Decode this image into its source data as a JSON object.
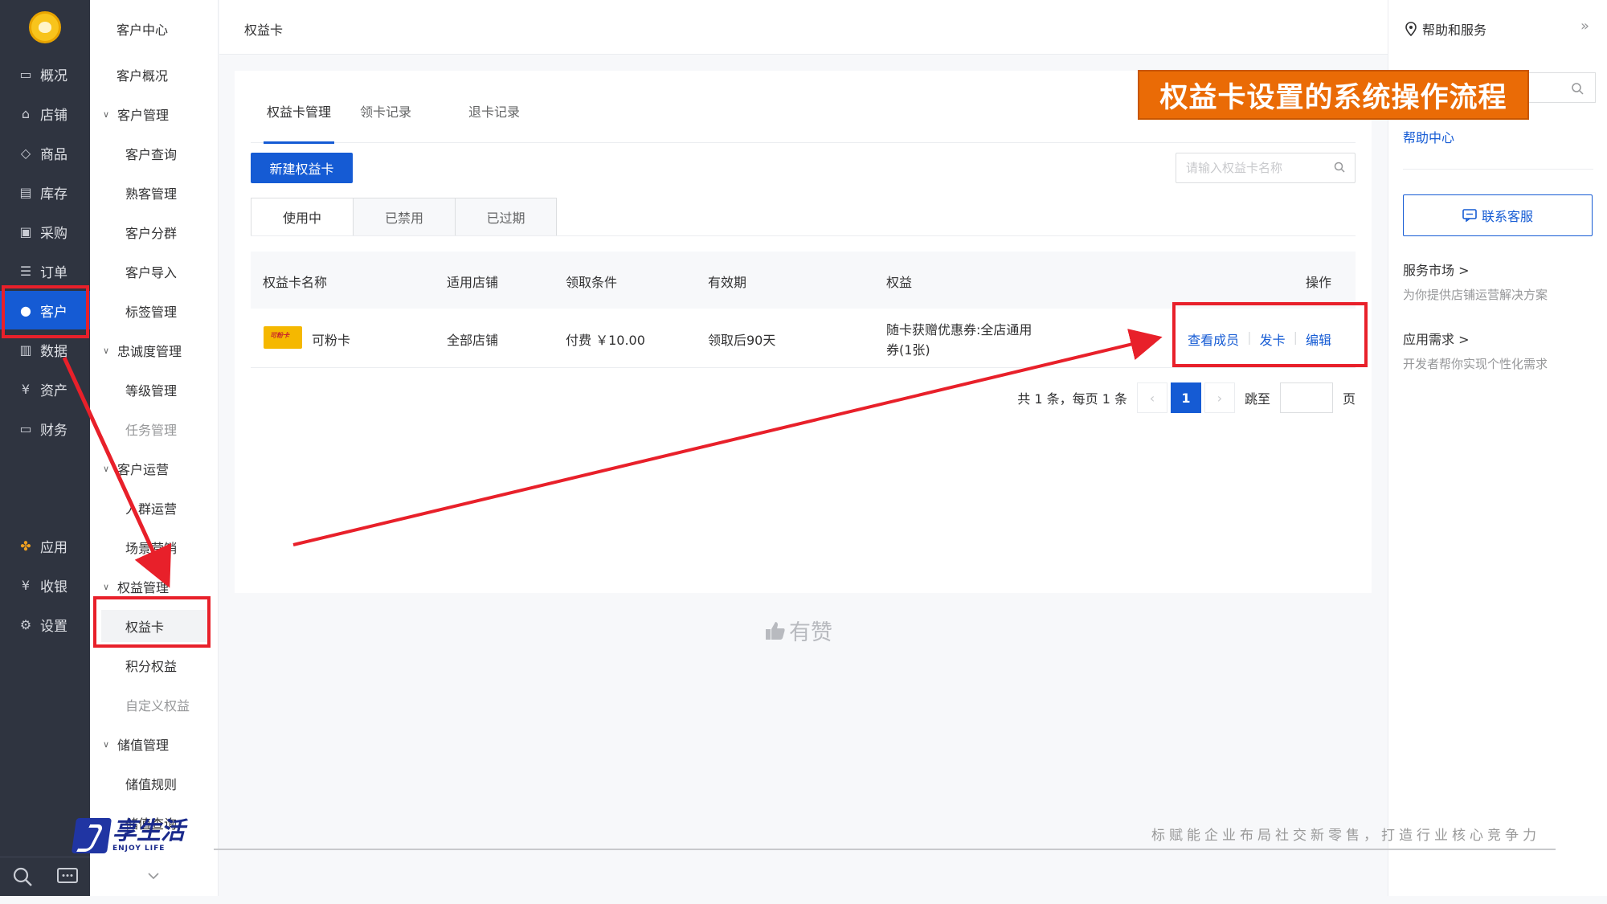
{
  "nav": {
    "items": [
      {
        "label": "概况",
        "icon": "chat-icon"
      },
      {
        "label": "店铺",
        "icon": "store-icon"
      },
      {
        "label": "商品",
        "icon": "tag-icon"
      },
      {
        "label": "库存",
        "icon": "inventory-icon"
      },
      {
        "label": "采购",
        "icon": "purchase-icon"
      },
      {
        "label": "订单",
        "icon": "order-icon"
      },
      {
        "label": "客户",
        "icon": "user-icon",
        "active": true
      },
      {
        "label": "数据",
        "icon": "chart-icon"
      },
      {
        "label": "资产",
        "icon": "yen-icon"
      },
      {
        "label": "财务",
        "icon": "wallet-icon"
      },
      {
        "label": "应用",
        "icon": "apps-icon"
      },
      {
        "label": "收银",
        "icon": "cashier-icon"
      },
      {
        "label": "设置",
        "icon": "gear-icon"
      }
    ]
  },
  "subnav": {
    "title": "客户中心",
    "items": [
      {
        "label": "客户概况",
        "type": "leaf-top"
      },
      {
        "label": "客户管理",
        "type": "group"
      },
      {
        "label": "客户查询",
        "type": "leaf"
      },
      {
        "label": "熟客管理",
        "type": "leaf"
      },
      {
        "label": "客户分群",
        "type": "leaf"
      },
      {
        "label": "客户导入",
        "type": "leaf"
      },
      {
        "label": "标签管理",
        "type": "leaf"
      },
      {
        "label": "忠诚度管理",
        "type": "group"
      },
      {
        "label": "等级管理",
        "type": "leaf"
      },
      {
        "label": "任务管理",
        "type": "leaf",
        "disabled": true
      },
      {
        "label": "客户运营",
        "type": "group"
      },
      {
        "label": "人群运营",
        "type": "leaf"
      },
      {
        "label": "场景营销",
        "type": "leaf"
      },
      {
        "label": "权益管理",
        "type": "group"
      },
      {
        "label": "权益卡",
        "type": "leaf",
        "selected": true
      },
      {
        "label": "积分权益",
        "type": "leaf"
      },
      {
        "label": "自定义权益",
        "type": "leaf",
        "disabled": true
      },
      {
        "label": "储值管理",
        "type": "group"
      },
      {
        "label": "储值规则",
        "type": "leaf"
      },
      {
        "label": "储值查询",
        "type": "leaf"
      }
    ]
  },
  "header": {
    "title": "权益卡"
  },
  "tabs": [
    "权益卡管理",
    "领卡记录",
    "退卡记录"
  ],
  "new_button": "新建权益卡",
  "search_placeholder": "请输入权益卡名称",
  "status_tabs": [
    "使用中",
    "已禁用",
    "已过期"
  ],
  "table": {
    "headers": [
      "权益卡名称",
      "适用店铺",
      "领取条件",
      "有效期",
      "权益",
      "操作"
    ],
    "rows": [
      {
        "thumb_text": "可粉卡",
        "name": "可粉卡",
        "store": "全部店铺",
        "condition": "付费 ￥10.00",
        "validity": "领取后90天",
        "benefit_line1": "随卡获赠优惠券:全店通用",
        "benefit_line2": "券(1张)",
        "actions": [
          "查看成员",
          "发卡",
          "编辑"
        ]
      }
    ]
  },
  "pager": {
    "summary": "共 1 条，每页 1 条",
    "current": "1",
    "jump_label": "跳至",
    "page_unit": "页"
  },
  "footer_logo": "有赞",
  "help": {
    "title": "帮助和服务",
    "help_center": "帮助中心",
    "contact": "联系客服",
    "services": [
      {
        "title": "服务市场 >",
        "desc": "为你提供店铺运营解决方案"
      },
      {
        "title": "应用需求 >",
        "desc": "开发者帮你实现个性化需求"
      }
    ]
  },
  "annotation": {
    "banner": "权益卡设置的系统操作流程",
    "slogan": "标赋能企业布局社交新零售，打造行业核心竞争力",
    "brand_cn": "享生活",
    "brand_en": "ENJOY LIFE",
    "accent": "#e8202a",
    "banner_color": "#ea6b06"
  },
  "colors": {
    "primary": "#155bd4",
    "nav_bg": "#2f3440"
  }
}
